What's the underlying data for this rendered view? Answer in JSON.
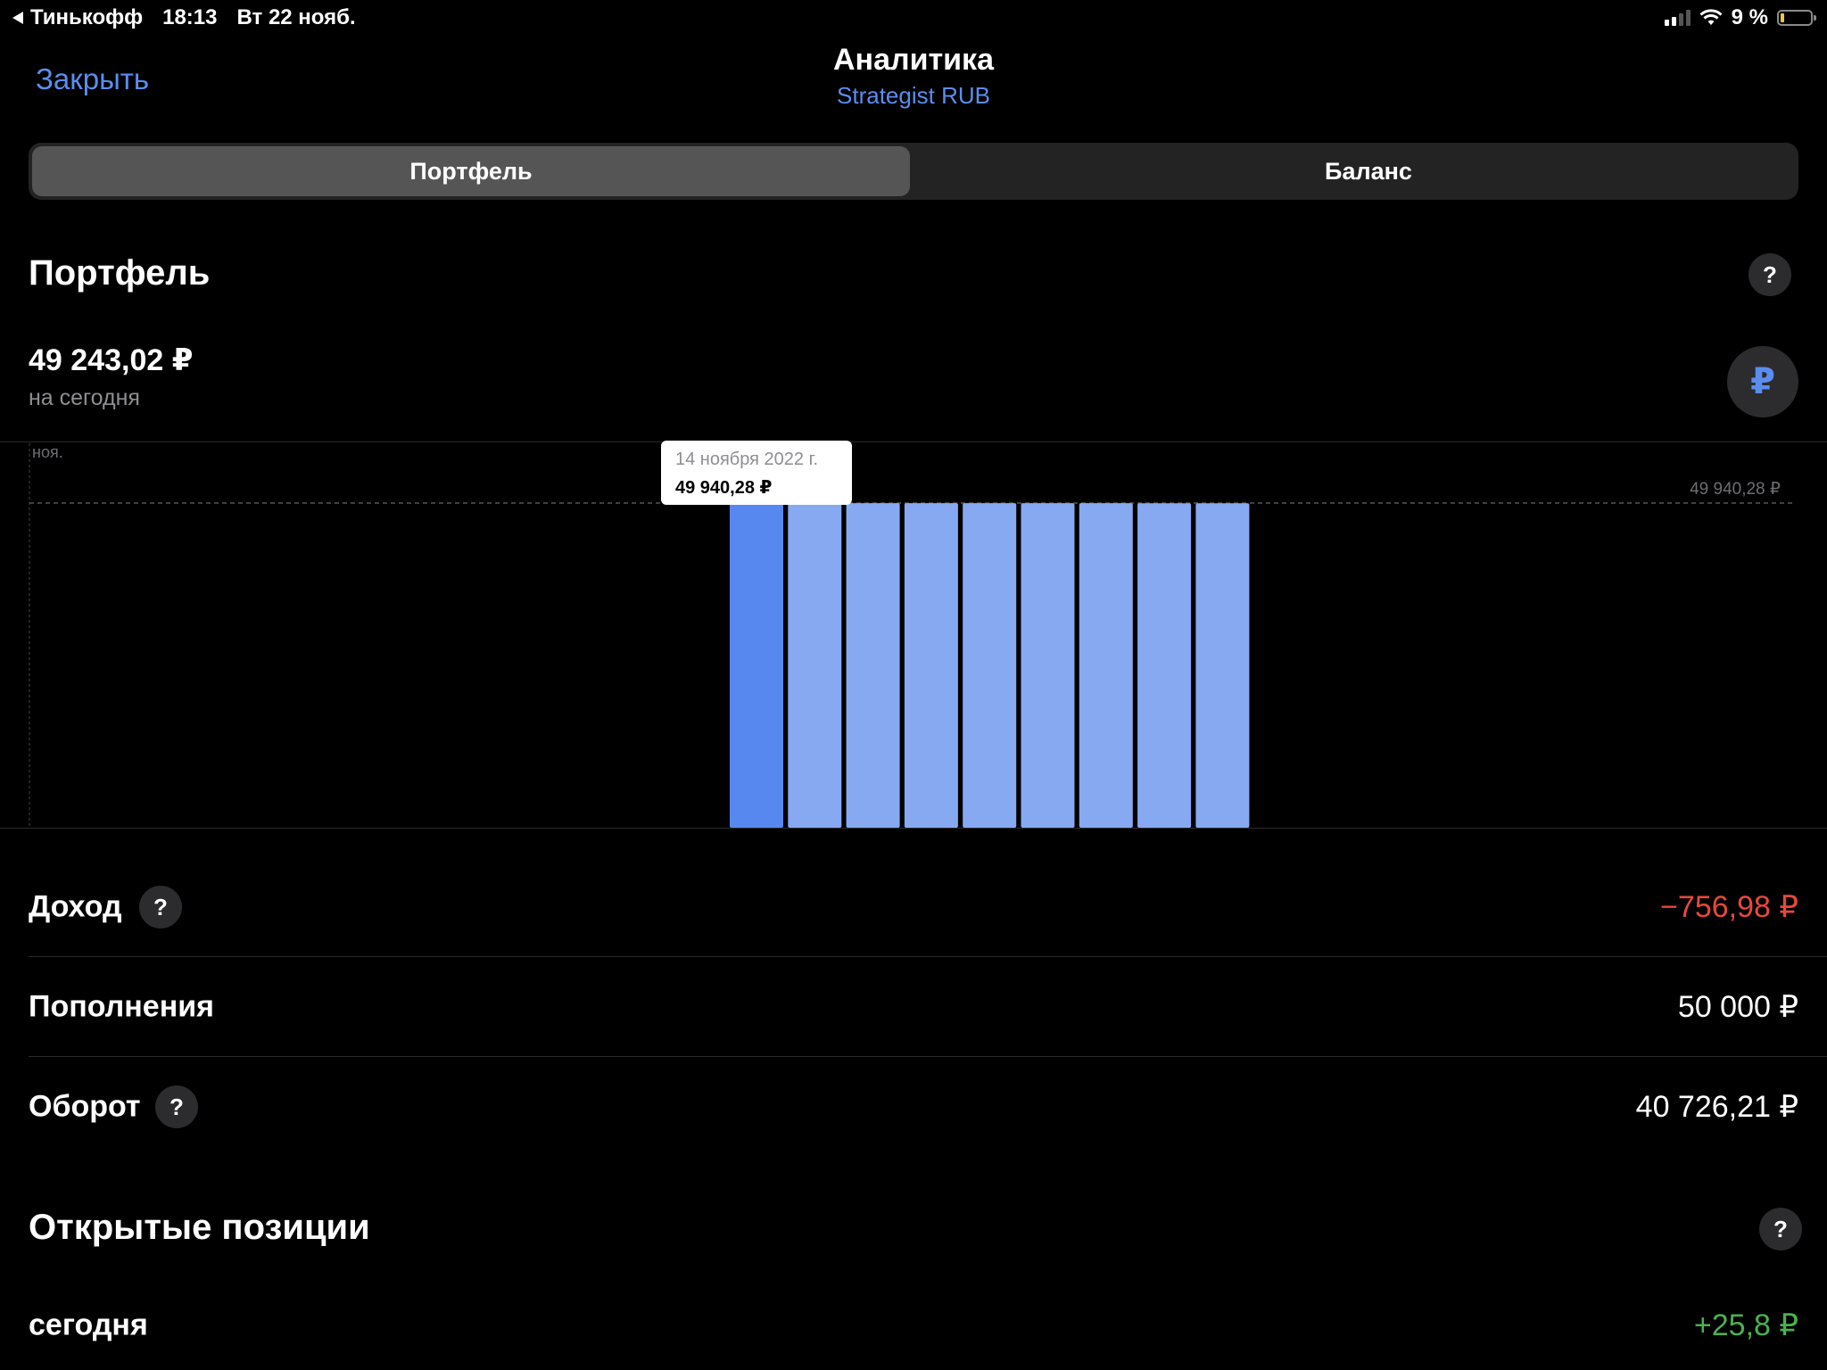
{
  "status_bar": {
    "back_app": "Тинькофф",
    "time": "18:13",
    "date": "Вт 22 нояб.",
    "battery": "9 %",
    "battery_level": 0.09
  },
  "nav": {
    "close": "Закрыть",
    "title": "Аналитика",
    "subtitle": "Strategist RUB"
  },
  "tabs": [
    {
      "label": "Портфель",
      "active": true
    },
    {
      "label": "Баланс",
      "active": false
    }
  ],
  "portfolio": {
    "title": "Портфель",
    "help": "?",
    "value": "49 243,02 ₽",
    "caption": "на сегодня",
    "currency_symbol": "₽"
  },
  "chart_data": {
    "type": "bar",
    "x_label_start": "ноя.",
    "ref_line_label": "49 940,28 ₽",
    "ref_value": 49940.28,
    "values": [
      49940.28,
      49910,
      49930,
      49925,
      49925,
      49925,
      49925,
      49910,
      49910
    ],
    "highlight_index": 0,
    "tooltip": {
      "date": "14 ноября 2022 г.",
      "value": "49 940,28 ₽"
    },
    "colors": {
      "highlight": "#5788f0",
      "bar": "#86a9f2"
    }
  },
  "metrics": [
    {
      "label": "Доход",
      "help": true,
      "value": "−756,98 ₽",
      "tone": "neg"
    },
    {
      "label": "Пополнения",
      "help": false,
      "value": "50 000 ₽",
      "tone": ""
    },
    {
      "label": "Оборот",
      "help": true,
      "value": "40 726,21 ₽",
      "tone": ""
    }
  ],
  "positions": {
    "title": "Открытые позиции",
    "help": "?",
    "today_label": "сегодня",
    "today_value": "+25,8 ₽"
  },
  "colors": {
    "accent": "#5b8def",
    "negative": "#e5493a",
    "positive": "#4cb050",
    "background": "#000000"
  }
}
